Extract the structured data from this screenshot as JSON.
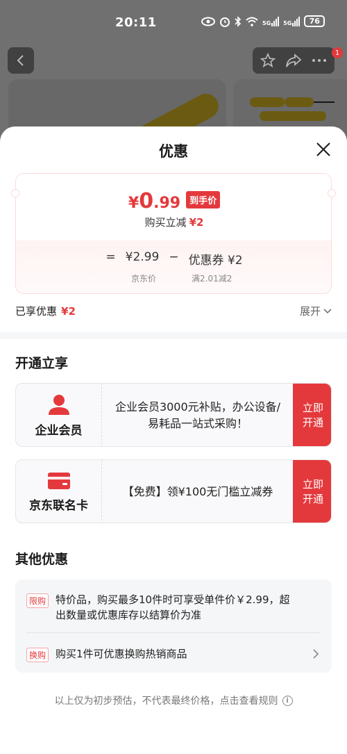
{
  "status_bar": {
    "time": "20:11",
    "network_1": "5G",
    "network_2": "5G",
    "battery": "76"
  },
  "nav": {
    "badge_count": "1"
  },
  "sheet": {
    "title": "优惠",
    "price_card": {
      "currency": "¥",
      "final_int": "0",
      "final_dec": ".99",
      "final_tag": "到手价",
      "discount_label": "购买立减",
      "discount_amount": "¥2",
      "eq": "=",
      "original_price": "¥2.99",
      "minus": "−",
      "coupon": "优惠券 ¥2",
      "original_label": "京东价",
      "coupon_condition": "满2.01减2"
    },
    "enjoyed": {
      "label": "已享优惠",
      "amount": "¥2",
      "expand": "展开"
    },
    "open_section": {
      "title": "开通立享",
      "cards": [
        {
          "name": "企业会员",
          "desc": "企业会员3000元补贴，办公设备/易耗品一站式采购！",
          "button": "立即开通"
        },
        {
          "name": "京东联名卡",
          "desc": "【免费】领¥100无门槛立减券",
          "button": "立即开通"
        }
      ]
    },
    "other_section": {
      "title": "其他优惠",
      "offers": [
        {
          "tag": "限购",
          "text": "特价品，购买最多10件时可享受单件价￥2.99，超出数量或优惠库存以结算价为准"
        },
        {
          "tag": "换购",
          "text": "购买1件可优惠换购热销商品"
        }
      ]
    },
    "footnote": "以上仅为初步预估，不代表最终价格，点击查看规则",
    "info_glyph": "i"
  },
  "colors": {
    "accent": "#e4393c",
    "card_border": "#fadada",
    "muted": "#888888"
  }
}
